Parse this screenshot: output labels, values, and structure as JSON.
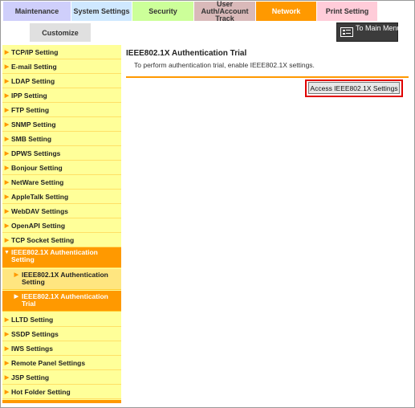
{
  "tabs": {
    "maintenance": "Maintenance",
    "system": "System Settings",
    "security": "Security",
    "userauth_line1": "User Auth/Account",
    "userauth_line2": "Track",
    "network": "Network",
    "print": "Print Setting"
  },
  "customize": "Customize",
  "main_menu": "To Main Menu",
  "sidebar": {
    "items_top": [
      "TCP/IP Setting",
      "E-mail Setting",
      "LDAP Setting",
      "IPP Setting",
      "FTP Setting",
      "SNMP Setting",
      "SMB Setting",
      "DPWS Settings",
      "Bonjour Setting",
      "NetWare Setting",
      "AppleTalk Setting",
      "WebDAV Settings",
      "OpenAPI Setting",
      "TCP Socket Setting"
    ],
    "open_group": {
      "line1": "IEEE802.1X Authentication",
      "line2": "Setting"
    },
    "sub_items": [
      {
        "line1": "IEEE802.1X Authentication",
        "line2": "Setting"
      },
      {
        "line1": "IEEE802.1X Authentication",
        "line2": "Trial"
      }
    ],
    "items_bottom": [
      "LLTD Setting",
      "SSDP Settings",
      "IWS Settings",
      "Remote Panel Settings",
      "JSP Setting",
      "Hot Folder Setting"
    ]
  },
  "content": {
    "title": "IEEE802.1X Authentication Trial",
    "description": "To perform authentication trial, enable IEEE802.1X settings.",
    "access_button": "Access IEEE802.1X Settings"
  },
  "colors": {
    "accent": "#ff9900",
    "sidebar_bg": "#ffff99",
    "highlight": "#e00000"
  }
}
